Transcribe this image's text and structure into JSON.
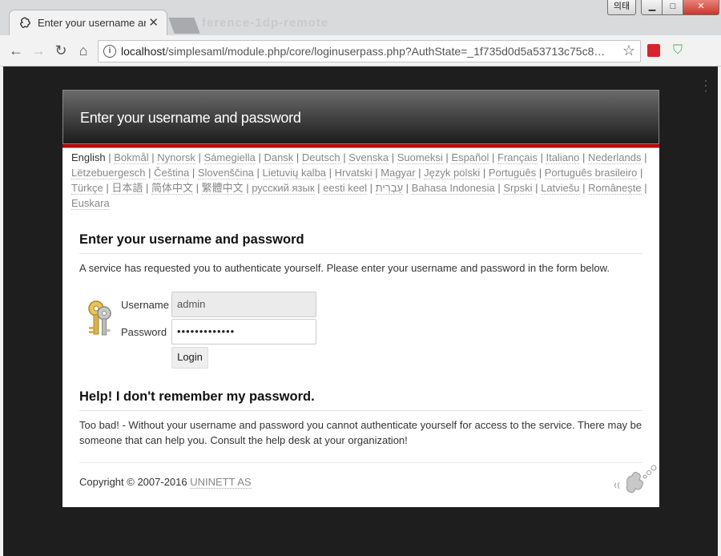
{
  "browser": {
    "tab_title": "Enter your username an",
    "tab_bg_text": "ference-1dp-remote",
    "window_buttons": {
      "ime": "의태"
    },
    "url_prefix": "localhost",
    "url_rest": "/simplesaml/module.php/core/loginuserpass.php?AuthState=_1f735d0d5a53713c75c8…"
  },
  "page": {
    "header_title": "Enter your username and password",
    "languages": [
      "English",
      "Bokmål",
      "Nynorsk",
      "Sámegiella",
      "Dansk",
      "Deutsch",
      "Svenska",
      "Suomeksi",
      "Español",
      "Français",
      "Italiano",
      "Nederlands",
      "Lëtzebuergesch",
      "Čeština",
      "Slovenščina",
      "Lietuvių kalba",
      "Hrvatski",
      "Magyar",
      "Język polski",
      "Português",
      "Português brasileiro",
      "Türkçe",
      "日本語",
      "简体中文",
      "繁體中文",
      "русский язык",
      "eesti keel",
      "עַבְרִית",
      "Bahasa Indonesia",
      "Srpski",
      "Latviešu",
      "Românește",
      "Euskara"
    ],
    "current_language": "English",
    "heading": "Enter your username and password",
    "intro": "A service has requested you to authenticate yourself. Please enter your username and password in the form below.",
    "form": {
      "username_label": "Username",
      "username_value": "admin",
      "password_label": "Password",
      "password_value": "•••••••••••••",
      "login_button": "Login"
    },
    "help_heading": "Help! I don't remember my password.",
    "help_text": "Too bad! - Without your username and password you cannot authenticate yourself for access to the service. There may be someone that can help you. Consult the help desk at your organization!",
    "copyright": "Copyright © 2007-2016 ",
    "copyright_link": "UNINETT AS"
  },
  "colors": {
    "header_dark": "#1c1c1c",
    "accent_red": "#bb0000"
  }
}
